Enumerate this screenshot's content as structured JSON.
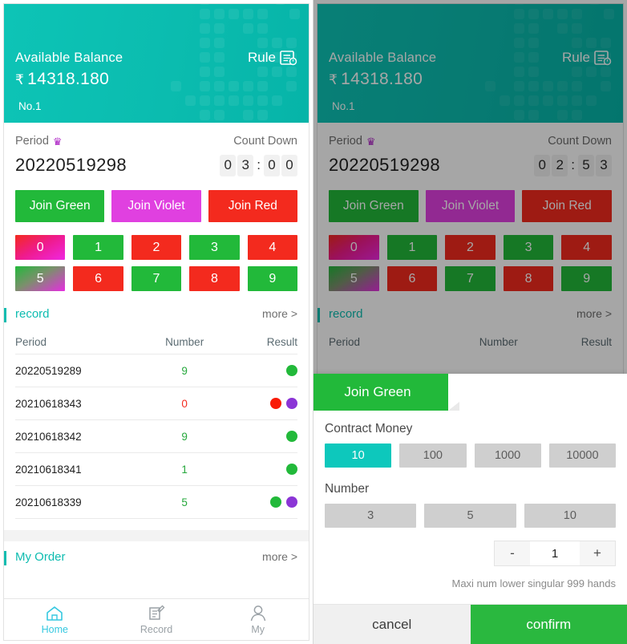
{
  "header": {
    "balance_label": "Available Balance",
    "currency_symbol": "₹",
    "balance_amount": "14318.180",
    "account_no": "No.1",
    "rule_label": "Rule",
    "rule_icon": "document-info-icon",
    "teal": "#0ec2b4"
  },
  "game": {
    "period_label": "Period",
    "crown_icon": "crown-icon",
    "countdown_label": "Count Down",
    "period_value": "20220519298",
    "countdown_left": [
      "0",
      "3",
      "0",
      "0"
    ],
    "countdown_right": [
      "0",
      "2",
      "5",
      "3"
    ],
    "countdown_separator": ":",
    "join_buttons": [
      {
        "label": "Join Green",
        "color": "#22b93a",
        "key": "green"
      },
      {
        "label": "Join Violet",
        "color": "#e040e0",
        "key": "violet"
      },
      {
        "label": "Join Red",
        "color": "#f32a1e",
        "key": "red"
      }
    ],
    "numbers": [
      {
        "label": "0",
        "style": "redvio"
      },
      {
        "label": "1",
        "style": "green"
      },
      {
        "label": "2",
        "style": "red"
      },
      {
        "label": "3",
        "style": "green"
      },
      {
        "label": "4",
        "style": "red"
      },
      {
        "label": "5",
        "style": "grnvio"
      },
      {
        "label": "6",
        "style": "red"
      },
      {
        "label": "7",
        "style": "green"
      },
      {
        "label": "8",
        "style": "red"
      },
      {
        "label": "9",
        "style": "green"
      }
    ]
  },
  "record": {
    "title": "record",
    "more_label": "more >",
    "columns": [
      "Period",
      "Number",
      "Result"
    ],
    "rows": [
      {
        "period": "20220519289",
        "number": "9",
        "number_color": "green",
        "dots": [
          "green"
        ]
      },
      {
        "period": "20210618343",
        "number": "0",
        "number_color": "red",
        "dots": [
          "red",
          "violet"
        ]
      },
      {
        "period": "20210618342",
        "number": "9",
        "number_color": "green",
        "dots": [
          "green"
        ]
      },
      {
        "period": "20210618341",
        "number": "1",
        "number_color": "green",
        "dots": [
          "green"
        ]
      },
      {
        "period": "20210618339",
        "number": "5",
        "number_color": "green",
        "dots": [
          "green",
          "violet"
        ]
      }
    ]
  },
  "my_order": {
    "title": "My Order",
    "more_label": "more >"
  },
  "bottom_nav": [
    {
      "label": "Home",
      "icon": "home-icon",
      "active": true
    },
    {
      "label": "Record",
      "icon": "document-edit-icon",
      "active": false
    },
    {
      "label": "My",
      "icon": "person-icon",
      "active": false
    }
  ],
  "bet_modal": {
    "tab_label": "Join Green",
    "contract_money_label": "Contract Money",
    "contract_amounts": [
      "10",
      "100",
      "1000",
      "10000"
    ],
    "contract_selected": "10",
    "number_label": "Number",
    "number_presets": [
      "3",
      "5",
      "10"
    ],
    "stepper_minus": "-",
    "stepper_plus": "+",
    "stepper_value": "1",
    "hint": "Maxi num lower singular 999 hands",
    "cancel_label": "cancel",
    "confirm_label": "confirm"
  }
}
